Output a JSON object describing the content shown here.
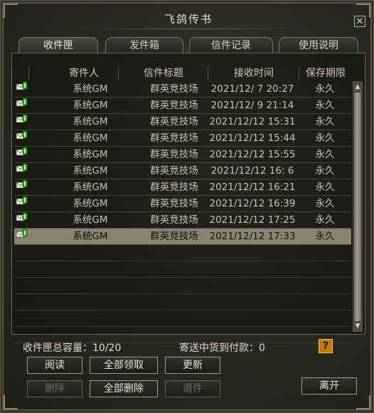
{
  "window": {
    "title": "飞鸽传书",
    "close_glyph": "✕"
  },
  "tabs": [
    {
      "label": "收件匣",
      "active": true
    },
    {
      "label": "发件箱",
      "active": false
    },
    {
      "label": "信件记录",
      "active": false
    },
    {
      "label": "使用说明",
      "active": false
    }
  ],
  "columns": {
    "sender": "寄件人",
    "subject": "信件标题",
    "received": "接收时间",
    "retention": "保存期限"
  },
  "mails": [
    {
      "sender": "系统GM",
      "subject": "群英竞技场",
      "received": "2021/12/ 7 20:27",
      "retention": "永久"
    },
    {
      "sender": "系统GM",
      "subject": "群英竞技场",
      "received": "2021/12/ 9 21:14",
      "retention": "永久"
    },
    {
      "sender": "系统GM",
      "subject": "群英竞技场",
      "received": "2021/12/12 15:31",
      "retention": "永久"
    },
    {
      "sender": "系统GM",
      "subject": "群英竞技场",
      "received": "2021/12/12 15:44",
      "retention": "永久"
    },
    {
      "sender": "系统GM",
      "subject": "群英竞技场",
      "received": "2021/12/12 15:55",
      "retention": "永久"
    },
    {
      "sender": "系统GM",
      "subject": "群英竞技场",
      "received": "2021/12/12 16: 6",
      "retention": "永久"
    },
    {
      "sender": "系统GM",
      "subject": "群英竞技场",
      "received": "2021/12/12 16:21",
      "retention": "永久"
    },
    {
      "sender": "系统GM",
      "subject": "群英竞技场",
      "received": "2021/12/12 16:39",
      "retention": "永久"
    },
    {
      "sender": "系统GM",
      "subject": "群英竞技场",
      "received": "2021/12/12 17:25",
      "retention": "永久"
    },
    {
      "sender": "系统GM",
      "subject": "群英竞技场",
      "received": "2021/12/12 17:33",
      "retention": "永久",
      "selected": true
    }
  ],
  "mail_icon": "mail-attachment-icon",
  "status": {
    "capacity": "收件匣总容量：10/20",
    "cod": "寄送中货到付款：0",
    "help_glyph": "?"
  },
  "buttons": {
    "read": "阅读",
    "claim_all": "全部领取",
    "refresh": "更新",
    "delete": "删除",
    "delete_all": "全部删除",
    "return": "退件",
    "leave": "离开"
  },
  "colors": {
    "selected_row": "#8a8372",
    "text": "#c9c3ad",
    "help_button": "#c07a10",
    "attachment_dot": "#19c21b"
  }
}
